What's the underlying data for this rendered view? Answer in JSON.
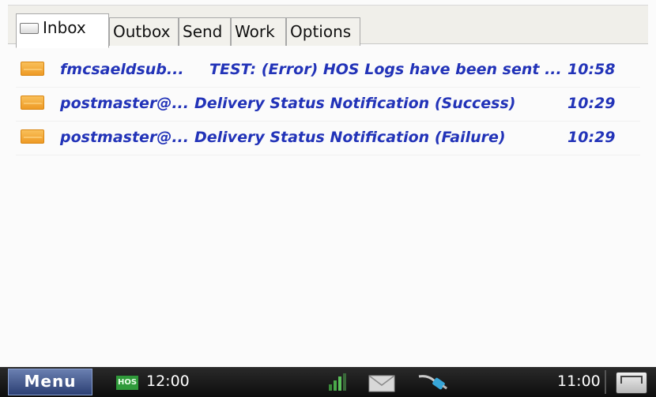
{
  "tabs": [
    {
      "label": "Inbox",
      "icon": "inbox-icon",
      "active": true
    },
    {
      "label": "Outbox",
      "active": false
    },
    {
      "label": "Send",
      "active": false
    },
    {
      "label": "Work",
      "active": false
    },
    {
      "label": "Options",
      "active": false
    }
  ],
  "messages": [
    {
      "icon": "envelope-icon",
      "from": "fmcsaeldsub...",
      "subject": "TEST:  (Error) HOS Logs have been sent ...",
      "time": "10:58"
    },
    {
      "icon": "envelope-icon",
      "from": "postmaster@...",
      "subject": "Delivery Status Notification (Success)",
      "time": "10:29"
    },
    {
      "icon": "envelope-icon",
      "from": "postmaster@...",
      "subject": "Delivery Status Notification (Failure)",
      "time": "10:29"
    }
  ],
  "taskbar": {
    "menu_label": "Menu",
    "hos_badge": "HOS",
    "hos_time": "12:00",
    "clock": "11:00",
    "icons": [
      "signal-icon",
      "mail-icon",
      "plug-icon",
      "keyboard-icon"
    ]
  },
  "colors": {
    "message_text": "#2233b8",
    "envelope": "#f0a030",
    "taskbar": "#111111",
    "menu_button": "#3b5088",
    "hos_badge": "#2f9a3a"
  }
}
